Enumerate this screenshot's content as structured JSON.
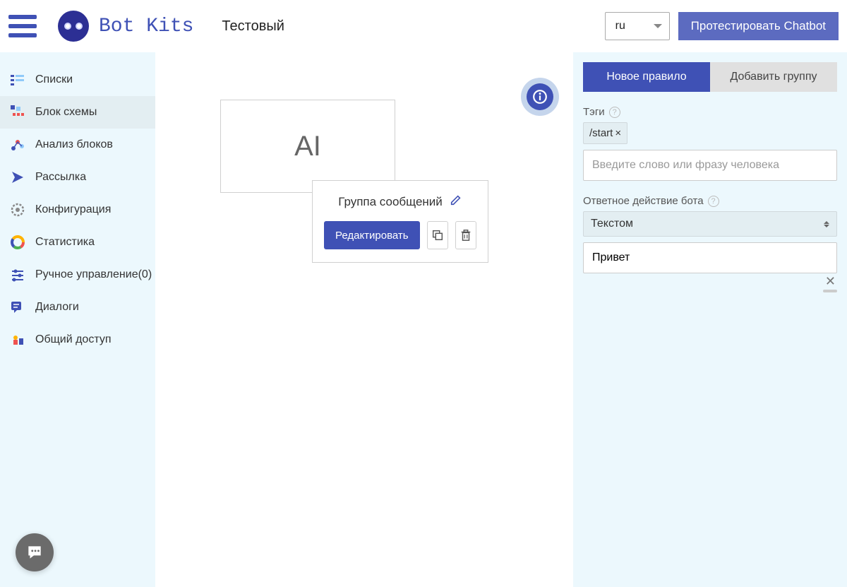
{
  "header": {
    "brand": "Bot Kits",
    "project": "Тестовый",
    "language": "ru",
    "test_button": "Протестировать Chatbot"
  },
  "sidebar": {
    "items": [
      {
        "label": "Списки"
      },
      {
        "label": "Блок схемы"
      },
      {
        "label": "Анализ блоков"
      },
      {
        "label": "Рассылка"
      },
      {
        "label": "Конфигурация"
      },
      {
        "label": "Статистика"
      },
      {
        "label": "Ручное управление(0)"
      },
      {
        "label": "Диалоги"
      },
      {
        "label": "Общий доступ"
      }
    ]
  },
  "canvas": {
    "block_label": "AI",
    "group_title": "Группа сообщений",
    "edit_button": "Редактировать"
  },
  "panel": {
    "tab_new_rule": "Новое правило",
    "tab_add_group": "Добавить группу",
    "tags_label": "Тэги",
    "tag_value": "/start",
    "phrase_placeholder": "Введите слово или фразу человека",
    "action_label": "Ответное действие бота",
    "action_value": "Текстом",
    "response_value": "Привет"
  }
}
